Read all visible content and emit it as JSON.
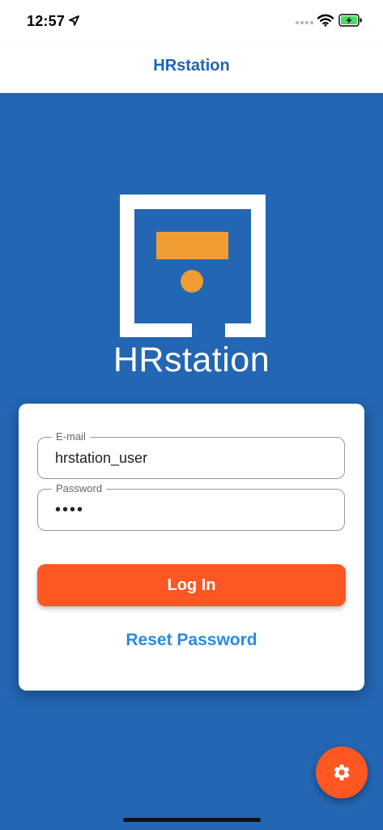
{
  "status_bar": {
    "time": "12:57",
    "icons": [
      "location-arrow-icon",
      "signal-dots-icon",
      "wifi-icon",
      "battery-charging-icon"
    ]
  },
  "nav": {
    "title": "HRstation"
  },
  "logo": {
    "text": "HRstation",
    "icon": "hrstation-logo-icon"
  },
  "login_form": {
    "email": {
      "label": "E-mail",
      "value": "hrstation_user"
    },
    "password": {
      "label": "Password",
      "value": "••••"
    },
    "login_button_label": "Log In",
    "reset_password_label": "Reset Password"
  },
  "settings_fab": {
    "icon": "gear-icon"
  },
  "colors": {
    "background": "#2366B3",
    "nav_title": "#1F64B4",
    "accent": "#FF5722",
    "logo_bar": "#EF9C33",
    "link": "#2A8BE0",
    "battery": "#4CD964"
  }
}
